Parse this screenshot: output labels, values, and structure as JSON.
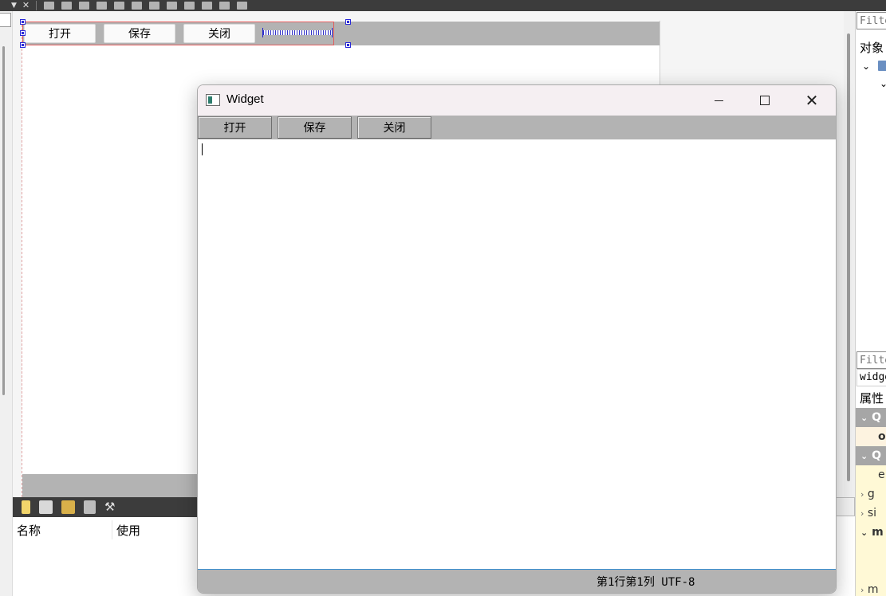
{
  "designer": {
    "form_buttons": [
      "打开",
      "保存",
      "关闭"
    ]
  },
  "object_inspector": {
    "filter_placeholder": "Filte",
    "title": "对象"
  },
  "property_editor": {
    "filter_placeholder": "Filte",
    "object_name": "widge",
    "title": "属性",
    "rows": [
      {
        "text": "Q",
        "kind": "group"
      },
      {
        "text": "o",
        "kind": "yellow-bold"
      },
      {
        "text": "Q",
        "kind": "group"
      },
      {
        "text": "e",
        "kind": "yellow"
      },
      {
        "text": "g",
        "kind": "yellow"
      },
      {
        "text": "si",
        "kind": "yellow"
      },
      {
        "text": "m",
        "kind": "yellow-bold"
      },
      {
        "text": "",
        "kind": "yellow"
      },
      {
        "text": "",
        "kind": "yellow"
      },
      {
        "text": "m",
        "kind": "yellow"
      }
    ]
  },
  "resource_browser": {
    "columns": [
      "名称",
      "使用"
    ]
  },
  "preview_window": {
    "title": "Widget",
    "buttons": [
      "打开",
      "保存",
      "关闭"
    ],
    "editor_text": "",
    "status": "第1行第1列 UTF-8"
  },
  "colors": {
    "toolbar_gray": "#b3b3b3",
    "dark_bar": "#3c3c3c",
    "selection_red": "#e05c5c",
    "handle_blue": "#2a2ad8",
    "titlebar": "#f5eff2"
  }
}
